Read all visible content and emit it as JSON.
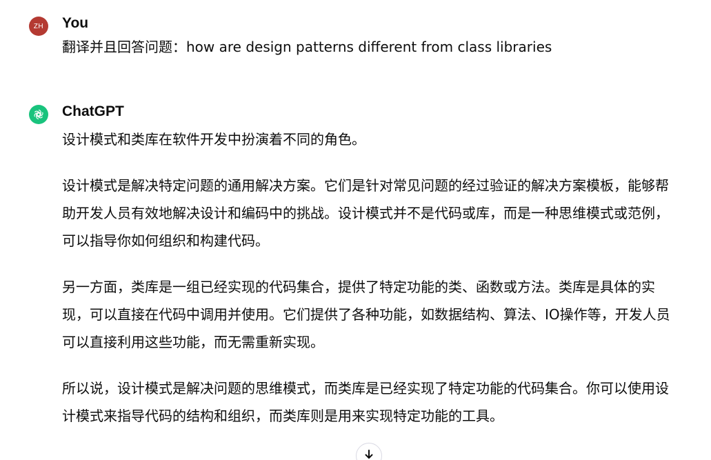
{
  "user_turn": {
    "avatar_initials": "ZH",
    "avatar_color": "#b43a32",
    "author": "You",
    "message": "翻译并且回答问题：how are design patterns different from class libraries"
  },
  "assistant_turn": {
    "avatar_icon": "openai-logo-icon",
    "avatar_color": "#19c37d",
    "author": "ChatGPT",
    "paragraphs": [
      "设计模式和类库在软件开发中扮演着不同的角色。",
      "设计模式是解决特定问题的通用解决方案。它们是针对常见问题的经过验证的解决方案模板，能够帮助开发人员有效地解决设计和编码中的挑战。设计模式并不是代码或库，而是一种思维模式或范例，可以指导你如何组织和构建代码。",
      "另一方面，类库是一组已经实现的代码集合，提供了特定功能的类、函数或方法。类库是具体的实现，可以直接在代码中调用并使用。它们提供了各种功能，如数据结构、算法、IO操作等，开发人员可以直接利用这些功能，而无需重新实现。",
      "所以说，设计模式是解决问题的思维模式，而类库是已经实现了特定功能的代码集合。你可以使用设计模式来指导代码的结构和组织，而类库则是用来实现特定功能的工具。"
    ]
  },
  "controls": {
    "scroll_down_icon": "arrow-down-icon"
  }
}
